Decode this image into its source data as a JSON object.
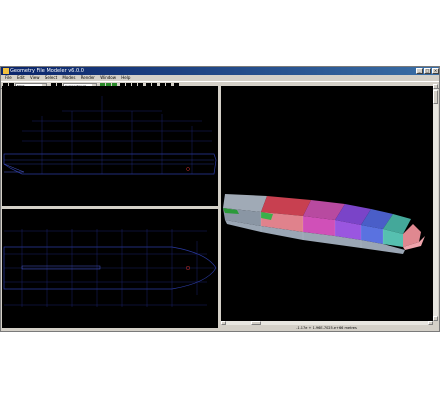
{
  "window": {
    "title": "Geometry File Modeler v6.0.0",
    "controls": {
      "minimize": "_",
      "maximize": "□",
      "close": "×"
    }
  },
  "menu": [
    "File",
    "Edit",
    "View",
    "Select",
    "Modes",
    "Render",
    "Window",
    "Help"
  ],
  "toolbar": {
    "selector_value": "FOOL",
    "combo_value": "Compartment"
  },
  "views": {
    "side_view": {
      "background": "#000000",
      "line_color": "#2a3aa0"
    },
    "top_view": {
      "background": "#000000",
      "line_color": "#2a3aa0"
    },
    "perspective_view": {
      "background": "#000000",
      "block_colors": [
        "#9aa6b4",
        "#d24a5a",
        "#c44aa6",
        "#8a4ad4",
        "#4a6ad4",
        "#4ab6a6",
        "#e08890",
        "#2a9a3a"
      ]
    }
  },
  "status": {
    "text": "-1.17e + 1.96E-7025.e+66 metres"
  }
}
